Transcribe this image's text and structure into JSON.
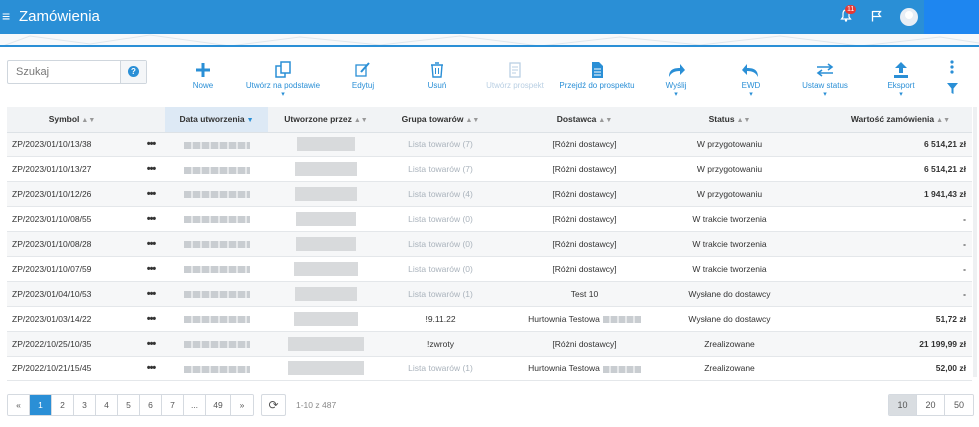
{
  "header": {
    "menu_icon": "hamburger-icon",
    "title": "Zamówienia",
    "notifications_count": "11",
    "colors": {
      "bar": "#2a8fd6",
      "user_box": "#1e86f0"
    }
  },
  "search": {
    "placeholder": "Szukaj"
  },
  "toolbar": {
    "new": "Nowe",
    "create_based": "Utwórz na podstawie",
    "edit": "Edytuj",
    "delete": "Usuń",
    "create_prospect": "Utwórz prospekt",
    "go_to_prospect": "Przejdź do prospektu",
    "send": "Wyślij",
    "ewd": "EWD",
    "set_status": "Ustaw status",
    "export": "Eksport"
  },
  "table": {
    "columns": {
      "symbol": "Symbol",
      "created_date": "Data utworzenia",
      "created_by": "Utworzone przez",
      "group": "Grupa towarów",
      "supplier": "Dostawca",
      "status": "Status",
      "value": "Wartość zamówienia"
    },
    "rows": [
      {
        "symbol": "ZP/2023/01/10/13/38",
        "group": "Lista towarów (7)",
        "supplier": "[Różni dostawcy]",
        "status": "W przygotowaniu",
        "value": "6 514,21 zł"
      },
      {
        "symbol": "ZP/2023/01/10/13/27",
        "group": "Lista towarów (7)",
        "supplier": "[Różni dostawcy]",
        "status": "W przygotowaniu",
        "value": "6 514,21 zł"
      },
      {
        "symbol": "ZP/2023/01/10/12/26",
        "group": "Lista towarów (4)",
        "supplier": "[Różni dostawcy]",
        "status": "W przygotowaniu",
        "value": "1 941,43 zł"
      },
      {
        "symbol": "ZP/2023/01/10/08/55",
        "group": "Lista towarów (0)",
        "supplier": "[Różni dostawcy]",
        "status": "W trakcie tworzenia",
        "value": "-"
      },
      {
        "symbol": "ZP/2023/01/10/08/28",
        "group": "Lista towarów (0)",
        "supplier": "[Różni dostawcy]",
        "status": "W trakcie tworzenia",
        "value": "-"
      },
      {
        "symbol": "ZP/2023/01/10/07/59",
        "group": "Lista towarów (0)",
        "supplier": "[Różni dostawcy]",
        "status": "W trakcie tworzenia",
        "value": "-"
      },
      {
        "symbol": "ZP/2023/01/04/10/53",
        "group": "Lista towarów (1)",
        "supplier": "Test 10",
        "status": "Wysłane do dostawcy",
        "value": "-"
      },
      {
        "symbol": "ZP/2023/01/03/14/22",
        "group": "!9.11.22",
        "supplier": "Hurtownia Testowa",
        "status": "Wysłane do dostawcy",
        "value": "51,72 zł"
      },
      {
        "symbol": "ZP/2022/10/25/10/35",
        "group": "!zwroty",
        "supplier": "[Różni dostawcy]",
        "status": "Zrealizowane",
        "value": "21 199,99 zł"
      },
      {
        "symbol": "ZP/2022/10/21/15/45",
        "group": "Lista towarów (1)",
        "supplier": "Hurtownia Testowa",
        "status": "Zrealizowane",
        "value": "52,00 zł"
      }
    ],
    "row_menu": "•••"
  },
  "pagination": {
    "prev": "«",
    "pages": [
      "1",
      "2",
      "3",
      "4",
      "5",
      "6",
      "7",
      "...",
      "49"
    ],
    "next": "»",
    "range_text": "1-10 z 487",
    "page_sizes": [
      "10",
      "20",
      "50"
    ]
  }
}
